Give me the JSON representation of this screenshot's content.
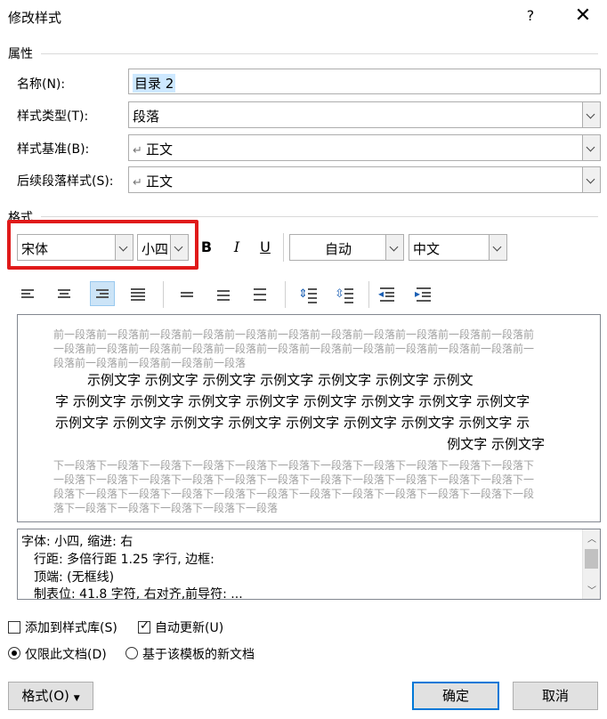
{
  "window": {
    "title": "修改样式",
    "help_label": "?",
    "close_label": "✕"
  },
  "properties": {
    "section_label": "属性",
    "name_label": "名称(N):",
    "name_value": "目录 2",
    "style_type_label": "样式类型(T):",
    "style_type_value": "段落",
    "based_on_label": "样式基准(B):",
    "based_on_value": "正文",
    "following_label": "后续段落样式(S):",
    "following_value": "正文"
  },
  "format": {
    "section_label": "格式",
    "font_value": "宋体",
    "size_value": "小四",
    "bold_label": "B",
    "italic_label": "I",
    "underline_label": "U",
    "color_value": "自动",
    "script_value": "中文"
  },
  "preview": {
    "prev_para": "前一段落前一段落前一段落前一段落前一段落前一段落前一段落前一段落前一段落前一段落前一段落前一段落前一段落前一段落前一段落前一段落前一段落前一段落前一段落前一段落前一段落前一段落前一段落前一段落前一段落前一段落前一段落",
    "sample_lines": [
      "示例文字  示例文字  示例文字  示例文字  示例文字  示例文字  示例文",
      "字  示例文字  示例文字  示例文字  示例文字  示例文字  示例文字  示例文字  示例文字",
      "示例文字  示例文字  示例文字  示例文字  示例文字  示例文字  示例文字  示例文字  示",
      "例文字  示例文字"
    ],
    "next_para": "下一段落下一段落下一段落下一段落下一段落下一段落下一段落下一段落下一段落下一段落下一段落下一段落下一段落下一段落下一段落下一段落下一段落下一段落下一段落下一段落下一段落下一段落下一段落下一段落下一段落下一段落下一段落下一段落下一段落下一段落下一段落下一段落下一段落下一段落下一段落下一段落下一段落下一段落下一段落"
  },
  "description": {
    "lines": [
      "字体: 小四, 缩进: 右",
      "行距: 多倍行距 1.25 字行, 边框:",
      "顶端: (无框线)",
      "制表位:  41.8 字符, 右对齐,前导符: ..."
    ]
  },
  "options": {
    "add_to_gallery_label": "添加到样式库(S)",
    "add_to_gallery_checked": false,
    "auto_update_label": "自动更新(U)",
    "auto_update_checked": true,
    "only_this_doc_label": "仅限此文档(D)",
    "new_docs_label": "基于该模板的新文档",
    "selected_scope": "only_this_doc"
  },
  "buttons": {
    "format_label": "格式(O)",
    "ok_label": "确定",
    "cancel_label": "取消"
  },
  "colors": {
    "highlight_box": "#e01a1a",
    "accent": "#0078d7",
    "selection": "#cde8ff"
  },
  "icons": {
    "toolbar": [
      "align-left-icon",
      "align-center-icon",
      "align-right-icon",
      "justify-icon",
      "single-spacing-icon",
      "one-half-spacing-icon",
      "double-spacing-icon",
      "increase-paragraph-spacing-icon",
      "decrease-paragraph-spacing-icon",
      "decrease-indent-icon",
      "increase-indent-icon"
    ]
  }
}
